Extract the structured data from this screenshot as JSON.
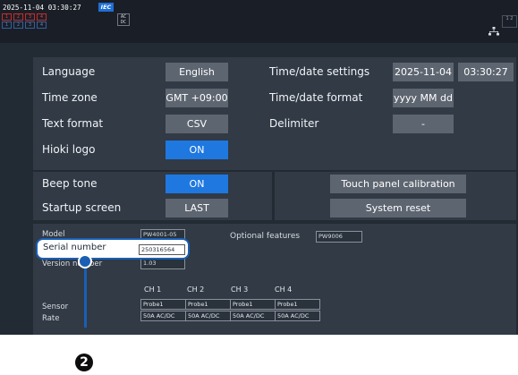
{
  "topbar": {
    "datetime": "2025-11-04 03:30:27",
    "iec_badge": "IEC",
    "channels_red": [
      "1",
      "2",
      "3",
      "4"
    ],
    "channels_blue": [
      "1",
      "2",
      "3",
      "4"
    ],
    "acdc": "AC DC",
    "corner": "1 2",
    "network_icon": "network-icon"
  },
  "settings": {
    "language": {
      "label": "Language",
      "value": "English"
    },
    "time_zone": {
      "label": "Time zone",
      "value": "GMT +09:00"
    },
    "text_format": {
      "label": "Text format",
      "value": "CSV"
    },
    "hioki_logo": {
      "label": "Hioki logo",
      "value": "ON"
    },
    "time_date_settings": {
      "label": "Time/date settings",
      "date": "2025-11-04",
      "time": "03:30:27"
    },
    "time_date_format": {
      "label": "Time/date format",
      "value": "yyyy MM dd"
    },
    "delimiter": {
      "label": "Delimiter",
      "value": "-"
    },
    "beep_tone": {
      "label": "Beep tone",
      "value": "ON"
    },
    "startup_screen": {
      "label": "Startup screen",
      "value": "LAST"
    },
    "touch_panel_calibration": "Touch panel calibration",
    "system_reset": "System reset"
  },
  "info": {
    "model": {
      "label": "Model",
      "value": "PW4001-05"
    },
    "serial_number": {
      "label": "Serial number",
      "value": "250316564"
    },
    "version_number": {
      "label": "Version number",
      "value": "1.03"
    },
    "optional_features": {
      "label": "Optional features",
      "value": "PW9006"
    },
    "channel_headers": [
      "CH 1",
      "CH 2",
      "CH 3",
      "CH 4"
    ],
    "sensor_label": "Sensor",
    "rate_label": "Rate",
    "sensors": [
      "Probe1",
      "Probe1",
      "Probe1",
      "Probe1"
    ],
    "rates": [
      "50A AC/DC",
      "50A AC/DC",
      "50A AC/DC",
      "50A AC/DC"
    ]
  },
  "callout": {
    "number": "2"
  },
  "colors": {
    "accent": "#1f78e0",
    "highlight": "#1a5fb4",
    "screen_bg": "#222a33"
  }
}
